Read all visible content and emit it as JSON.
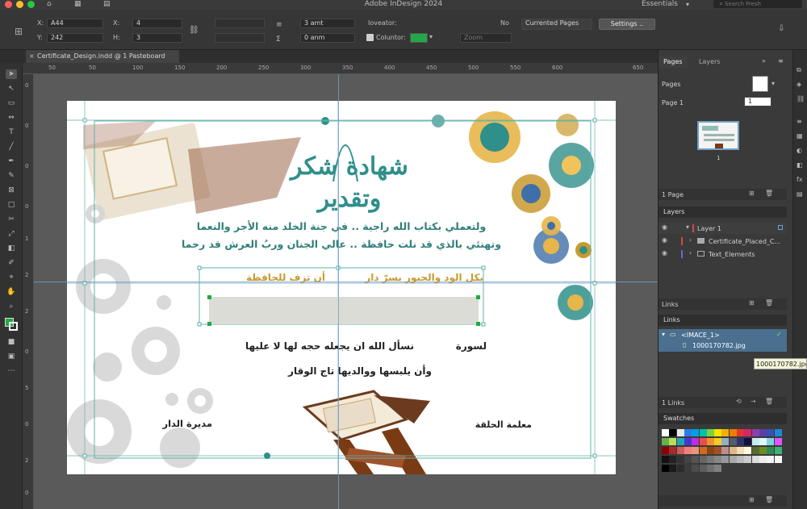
{
  "app": {
    "title": "Adobe InDesign 2024",
    "workspace": "Essentials",
    "search_placeholder": "Search Fresh"
  },
  "control": {
    "x_label": "X:",
    "x_value": "A44",
    "y_label": "Y:",
    "y_value": "242",
    "x2_label": "X:",
    "x2_value": "4",
    "h_label": "H:",
    "h_value": "3",
    "stroke_value": "3 amt",
    "offset_value": "0 anm",
    "locator_label": "Ioveator:",
    "locator_value": "No",
    "pages_value": "Currented Pages",
    "settings_button": "Settings ..",
    "colour_label": "Coluntor:",
    "zoom_placeholder": "Zoom",
    "accent_color": "#22a845"
  },
  "document_tab": "Certificate_Design.indd @ 1 Pasteboard",
  "ruler": {
    "h_ticks": [
      "50",
      "50",
      "100",
      "150",
      "200",
      "250",
      "300",
      "350",
      "400",
      "450",
      "500",
      "550",
      "600",
      "650"
    ],
    "v_ticks": [
      "0",
      "0",
      "0",
      "0",
      "1",
      "2",
      "2",
      "0",
      "5",
      "0",
      "2",
      "0"
    ]
  },
  "certificate": {
    "headline": "شهادة شكر وتقدير",
    "line1": "ولتعملي بكتاب الله راجية .. في جنة الخلد منه الأجر والنعما",
    "line2": "وتهنئي بالذي قد نلت حافظة .. عالي الجنان وربُ العرش قد رحما",
    "gold_right": "بكل الود والحبور يسرّ دار",
    "gold_left": "أن تزف للحافظة",
    "surah_label": "لسورة",
    "prayer1": "نسأل الله ان يجعله حجه لها لا عليها",
    "prayer2": "وأن يلبسها ووالديها تاج الوقار",
    "sign_left": "مديرة الدار",
    "sign_right": "معلمة الحلقة"
  },
  "pages_panel": {
    "tab_pages": "Pages",
    "tab_layers": "Layers",
    "pages_label": "Pages",
    "page_label": "Page 1",
    "page_field": "1",
    "thumb_number": "1",
    "footer": "1 Page"
  },
  "layers_panel": {
    "title": "Layers",
    "layer1": "Layer 1",
    "sub1": "Certificate_Placed_C...",
    "sub2": "Text_Elements",
    "footer": "Links"
  },
  "links_panel": {
    "title": "Links",
    "item1": "<IMACE_1>",
    "item2": "1000170782.jpg",
    "tooltip": "1000170782.jpg",
    "footer": "1 Links"
  },
  "swatches_panel": {
    "title": "Swatches"
  },
  "colors": {
    "teal": "#2f8f8a",
    "gold": "#c99a2e",
    "selection": "#5fb3a8",
    "swatches_row1": [
      "#ffffff",
      "#000000",
      "#e8e8e8",
      "#2c7be5",
      "#00a0e6",
      "#00c2a8",
      "#7fd13b",
      "#f2e400",
      "#f4b000",
      "#ef7d00",
      "#e3342f",
      "#d6246e",
      "#8e3fa8",
      "#5b3fa8",
      "#3a4fb0",
      "#1e88d6"
    ],
    "swatches_row2": [
      "#6ab04c",
      "#badc58",
      "#22a6b3",
      "#4834d4",
      "#be2edd",
      "#eb4d4b",
      "#f0932b",
      "#f9ca24",
      "#95afc0",
      "#535c68",
      "#30336b",
      "#130f40",
      "#c7ecee",
      "#dff9fb",
      "#7ed6df",
      "#e056fd"
    ],
    "swatches_row3": [
      "#8b0000",
      "#a52a2a",
      "#cd5c5c",
      "#f08080",
      "#e9967a",
      "#d2691e",
      "#8b4513",
      "#a0522d",
      "#bc8f8f",
      "#deb887",
      "#f5deb3",
      "#fff8dc",
      "#556b2f",
      "#6b8e23",
      "#2e8b57",
      "#3cb371"
    ],
    "swatches_row4": [
      "#111111",
      "#222222",
      "#333333",
      "#444444",
      "#555555",
      "#666666",
      "#777777",
      "#888888",
      "#999999",
      "#aaaaaa",
      "#bbbbbb",
      "#cccccc",
      "#dddddd",
      "#eeeeee",
      "#f5f5f5",
      "#fafafa"
    ],
    "swatches_row5": [
      "#000000",
      "#1a1a1a",
      "#2b2b2b",
      "#3c3c3c",
      "#4d4d4d",
      "#5e5e5e",
      "#6f6f6f",
      "#808080"
    ]
  }
}
